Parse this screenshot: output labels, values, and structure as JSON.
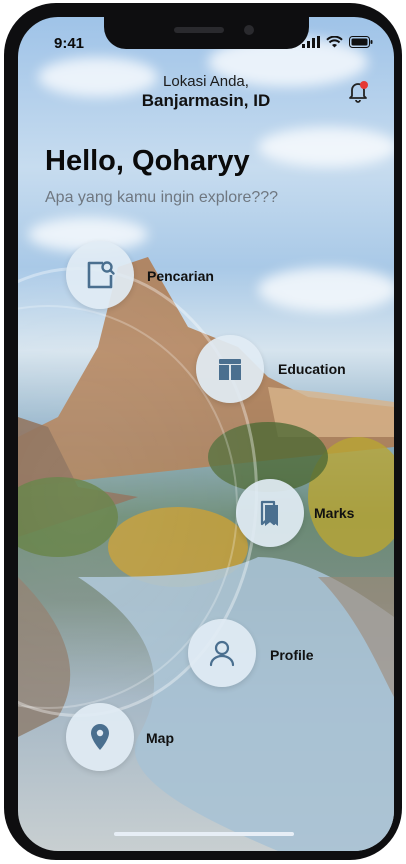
{
  "status_bar": {
    "time": "9:41"
  },
  "header": {
    "location_label": "Lokasi Anda,",
    "location_value": "Banjarmasin, ID"
  },
  "greeting": {
    "title": "Hello, Qoharyy",
    "subtitle": "Apa yang kamu ingin explore???"
  },
  "menu": {
    "search": {
      "label": "Pencarian",
      "icon": "search-document-icon"
    },
    "education": {
      "label": "Education",
      "icon": "book-icon"
    },
    "marks": {
      "label": "Marks",
      "icon": "bookmarks-icon"
    },
    "profile": {
      "label": "Profile",
      "icon": "user-icon"
    },
    "map": {
      "label": "Map",
      "icon": "map-pin-icon"
    }
  },
  "colors": {
    "icon_blue": "#4a6f8f",
    "button_bg": "#e1ebf4",
    "notification_dot": "#e53935"
  }
}
